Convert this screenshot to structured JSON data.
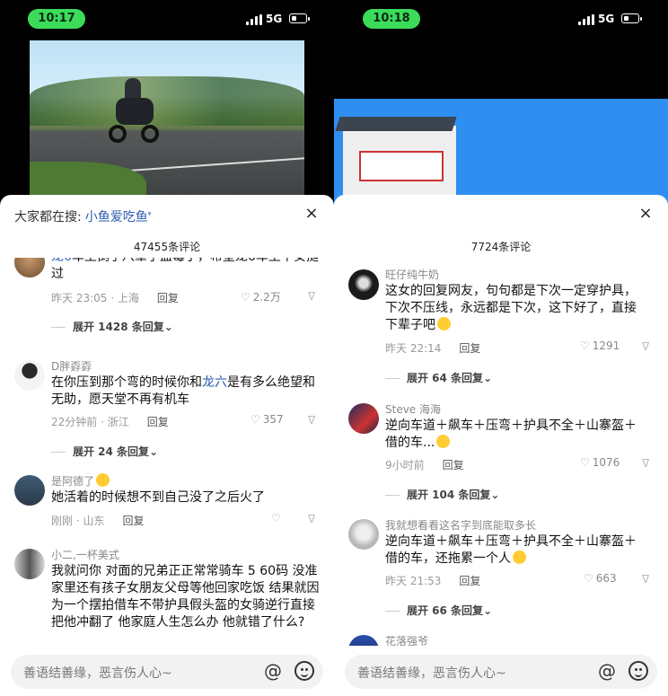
{
  "left": {
    "status": {
      "time": "10:17",
      "network": "5G"
    },
    "search_prefix": "大家都在搜:",
    "search_query": "小鱼爱吃鱼",
    "search_icon": "search-icon",
    "close": "×",
    "comment_count": "47455条评论",
    "comments": [
      {
        "text_link": "龙6",
        "text_rest": "车主倒了八辈子血霉了，希望龙6车主平安挺过",
        "meta": "昨天 23:05 · 上海",
        "reply": "回复",
        "likes": "2.2万",
        "expand": "展开 1428 条回复"
      },
      {
        "user": "D胖孬孬",
        "text_a": "在你压到那个弯的时候你和",
        "text_link": "龙六",
        "text_b": "是有多么绝望和无助，愿天堂不再有机车",
        "meta": "22分钟前 · 浙江",
        "reply": "回复",
        "likes": "357",
        "expand": "展开 24 条回复"
      },
      {
        "user": "是阿德了",
        "text": "她活着的时候想不到自己没了之后火了",
        "meta": "刚刚 · 山东",
        "reply": "回复"
      },
      {
        "user": "小二,一杯美式",
        "text": "我就问你 对面的兄弟正正常常骑车 5 60码 没准家里还有孩子女朋友父母等他回家吃饭 结果就因为一个摆拍借车不带护具假头盔的女骑逆行直接把他冲翻了 他家庭人生怎么办 他就错了什么?"
      }
    ],
    "input_placeholder": "善语结善缘，恶言伤人心~"
  },
  "right": {
    "status": {
      "time": "10:18",
      "network": "5G"
    },
    "close": "×",
    "comment_count": "7724条评论",
    "comments": [
      {
        "user": "旺仔纯牛奶",
        "text": "这女的回复网友，句句都是下次一定穿护具，下次不压线，永远都是下次，这下好了，直接下辈子吧",
        "meta": "昨天 22:14",
        "reply": "回复",
        "likes": "1291",
        "expand": "展开 64 条回复"
      },
      {
        "user": "Steve 海海",
        "text": "逆向车道＋飙车＋压弯＋护具不全＋山寨盔＋借的车...",
        "meta": "9小时前",
        "reply": "回复",
        "likes": "1076",
        "expand": "展开 104 条回复"
      },
      {
        "user": "我就想看看这名字到底能取多长",
        "text": "逆向车道＋飙车＋压弯＋护具不全＋山寨盔＋借的车，还拖累一个人",
        "meta": "昨天 21:53",
        "reply": "回复",
        "likes": "663",
        "expand": "展开 66 条回复"
      },
      {
        "user": "花落强爷"
      }
    ],
    "input_placeholder": "善语结善缘，恶言伤人心~"
  },
  "icons": {
    "at": "@",
    "dislike": "ᐁ",
    "heart": "♡",
    "chevron": "⌄"
  },
  "colors": {
    "status_pill": "#3bdc5a",
    "link": "#2a5bb0"
  }
}
